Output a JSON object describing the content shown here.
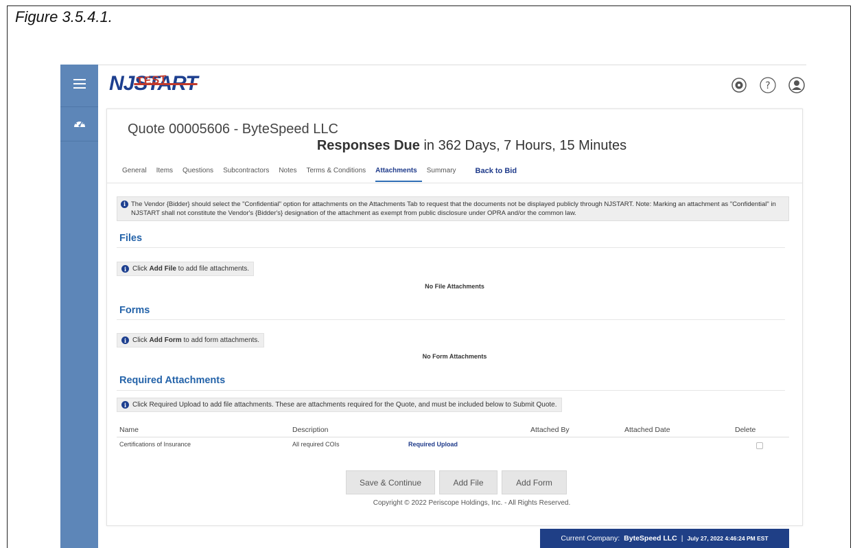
{
  "figure_caption": "Figure 3.5.4.1.",
  "logo": {
    "nj": "NJ",
    "start": "START",
    "test": "TEST"
  },
  "header": {
    "quote_title": "Quote 00005606 - ByteSpeed LLC",
    "responses_label": "Responses Due",
    "responses_text": " in 362 Days, 7 Hours, 15 Minutes"
  },
  "tabs": [
    {
      "label": "General",
      "active": false
    },
    {
      "label": "Items",
      "active": false
    },
    {
      "label": "Questions",
      "active": false
    },
    {
      "label": "Subcontractors",
      "active": false
    },
    {
      "label": "Notes",
      "active": false
    },
    {
      "label": "Terms & Conditions",
      "active": false
    },
    {
      "label": "Attachments",
      "active": true
    },
    {
      "label": "Summary",
      "active": false
    }
  ],
  "back_to_bid": "Back to Bid",
  "notice": "The Vendor {Bidder} should select the \"Confidential\" option for attachments on the Attachments Tab to request that the documents not be displayed publicly through NJSTART. Note: Marking an attachment as \"Confidential\" in NJSTART shall not constitute the Vendor's {Bidder's} designation of the attachment as exempt from public disclosure under OPRA and/or the common law.",
  "files": {
    "heading": "Files",
    "hint_pre": "Click ",
    "hint_bold": "Add File",
    "hint_post": " to add file attachments.",
    "empty": "No File Attachments"
  },
  "forms": {
    "heading": "Forms",
    "hint_pre": "Click ",
    "hint_bold": "Add Form",
    "hint_post": " to add form attachments.",
    "empty": "No Form Attachments"
  },
  "required": {
    "heading": "Required Attachments",
    "hint": "Click Required Upload to add file attachments. These are attachments required for the Quote, and must be included below to Submit Quote.",
    "columns": {
      "name": "Name",
      "description": "Description",
      "attached_by": "Attached By",
      "attached_date": "Attached Date",
      "delete": "Delete"
    },
    "rows": [
      {
        "name": "Certifications of Insurance",
        "description": "All required COIs",
        "action": "Required Upload",
        "attached_by": "",
        "attached_date": ""
      }
    ]
  },
  "buttons": {
    "save_continue": "Save & Continue",
    "add_file": "Add File",
    "add_form": "Add Form"
  },
  "copyright": "Copyright © 2022 Periscope Holdings, Inc. - All Rights Reserved.",
  "footer": {
    "company_label": "Current Company:",
    "company_name": "ByteSpeed LLC",
    "separator": "|",
    "datetime": "July 27, 2022 4:46:24 PM EST"
  },
  "icons": [
    "menu-icon",
    "dashboard-icon",
    "settings-icon",
    "help-icon",
    "user-icon",
    "info-icon"
  ],
  "colors": {
    "sidebar": "#5d86b8",
    "accent": "#2463a9",
    "brand": "#1d3f8f",
    "footer": "#1f3f86"
  }
}
